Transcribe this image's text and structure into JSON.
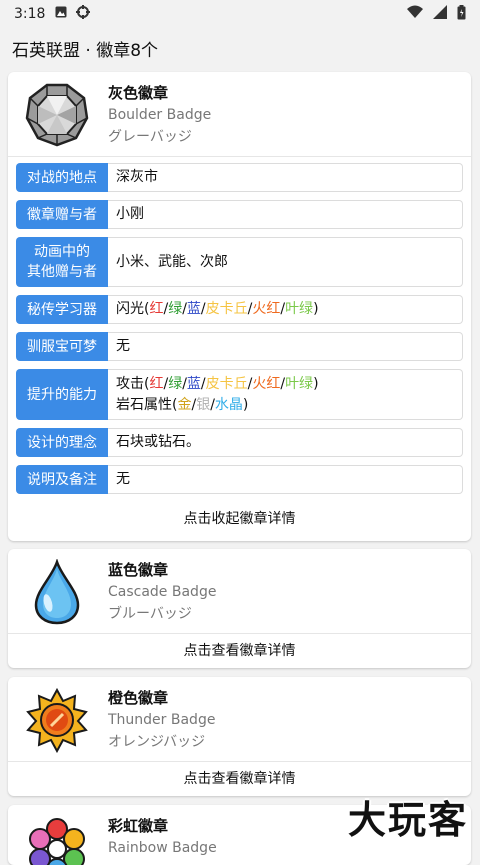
{
  "status": {
    "time": "3:18"
  },
  "appbar": {
    "title": "石英联盟 · 徽章8个"
  },
  "badges": [
    {
      "name": "灰色徽章",
      "en": "Boulder Badge",
      "jp": "グレーバッジ",
      "rows": {
        "location": {
          "label": "对战的地点",
          "value": "深灰市"
        },
        "giver": {
          "label": "徽章赠与者",
          "value": "小刚"
        },
        "anime": {
          "label1": "动画中的",
          "label2": "其他赠与者",
          "value": "小米、武能、次郎"
        },
        "hm": {
          "label": "秘传学习器",
          "move": "闪光",
          "versions": [
            "红",
            "绿",
            "蓝",
            "皮卡丘",
            "火红",
            "叶绿"
          ]
        },
        "obey": {
          "label": "驯服宝可梦",
          "value": "无"
        },
        "boost": {
          "label": "提升的能力",
          "line1_prefix": "攻击",
          "versions": [
            "红",
            "绿",
            "蓝",
            "皮卡丘",
            "火红",
            "叶绿"
          ],
          "line2_prefix": "岩石属性",
          "versions2": [
            "金",
            "银",
            "水晶"
          ]
        },
        "design": {
          "label": "设计的理念",
          "value": "石块或钻石。"
        },
        "notes": {
          "label": "说明及备注",
          "value": "无"
        }
      },
      "toggle": "点击收起徽章详情"
    },
    {
      "name": "蓝色徽章",
      "en": "Cascade Badge",
      "jp": "ブルーバッジ",
      "toggle": "点击查看徽章详情"
    },
    {
      "name": "橙色徽章",
      "en": "Thunder Badge",
      "jp": "オレンジバッジ",
      "toggle": "点击查看徽章详情"
    },
    {
      "name": "彩虹徽章",
      "en": "Rainbow Badge"
    }
  ],
  "punct": {
    "open": "(",
    "close": ")",
    "slash": "/"
  },
  "watermark": "大玩客",
  "colors": {
    "label_bg": "#3b8be6",
    "red": "#e53935",
    "green": "#2f9e33",
    "blue": "#2e49c8",
    "pikachu": "#f5c443",
    "firered": "#ef6a1f",
    "leafgreen": "#7bc94a",
    "gold": "#d0a21a",
    "silver": "#b0b0b0",
    "crystal": "#33aee8"
  },
  "icons": [
    "image-icon",
    "settings-app-icon",
    "wifi-icon",
    "signal-icon",
    "battery-icon",
    "boulder-badge-icon",
    "cascade-badge-icon",
    "thunder-badge-icon",
    "rainbow-badge-icon"
  ]
}
